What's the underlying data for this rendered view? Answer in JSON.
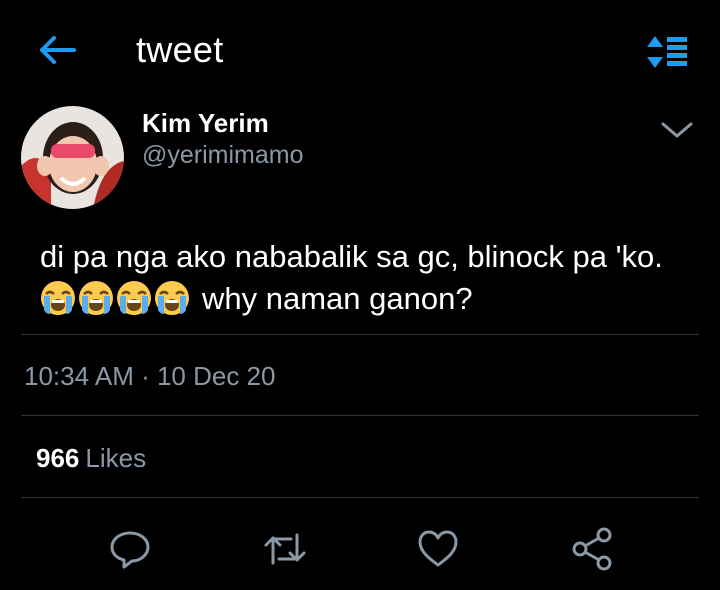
{
  "header": {
    "title": "tweet",
    "accent": "#1d9bf0"
  },
  "tweet": {
    "author_name": "Kim Yerim",
    "author_handle": "@yerimimamo",
    "text_line1": "di pa nga ako nababalik sa gc, blinock pa 'ko.",
    "emoji": [
      "loudly-crying-face",
      "loudly-crying-face",
      "loudly-crying-face",
      "loudly-crying-face"
    ],
    "text_line2": "why naman ganon?",
    "timestamp": "10:34 AM · 10 Dec 20",
    "likes_count": "966",
    "likes_label": "Likes"
  },
  "actions": [
    "reply-icon",
    "retweet-icon",
    "like-icon",
    "share-icon"
  ],
  "colors": {
    "background": "#000000",
    "secondary_text": "#8b98a5",
    "divider": "#2f3336"
  }
}
